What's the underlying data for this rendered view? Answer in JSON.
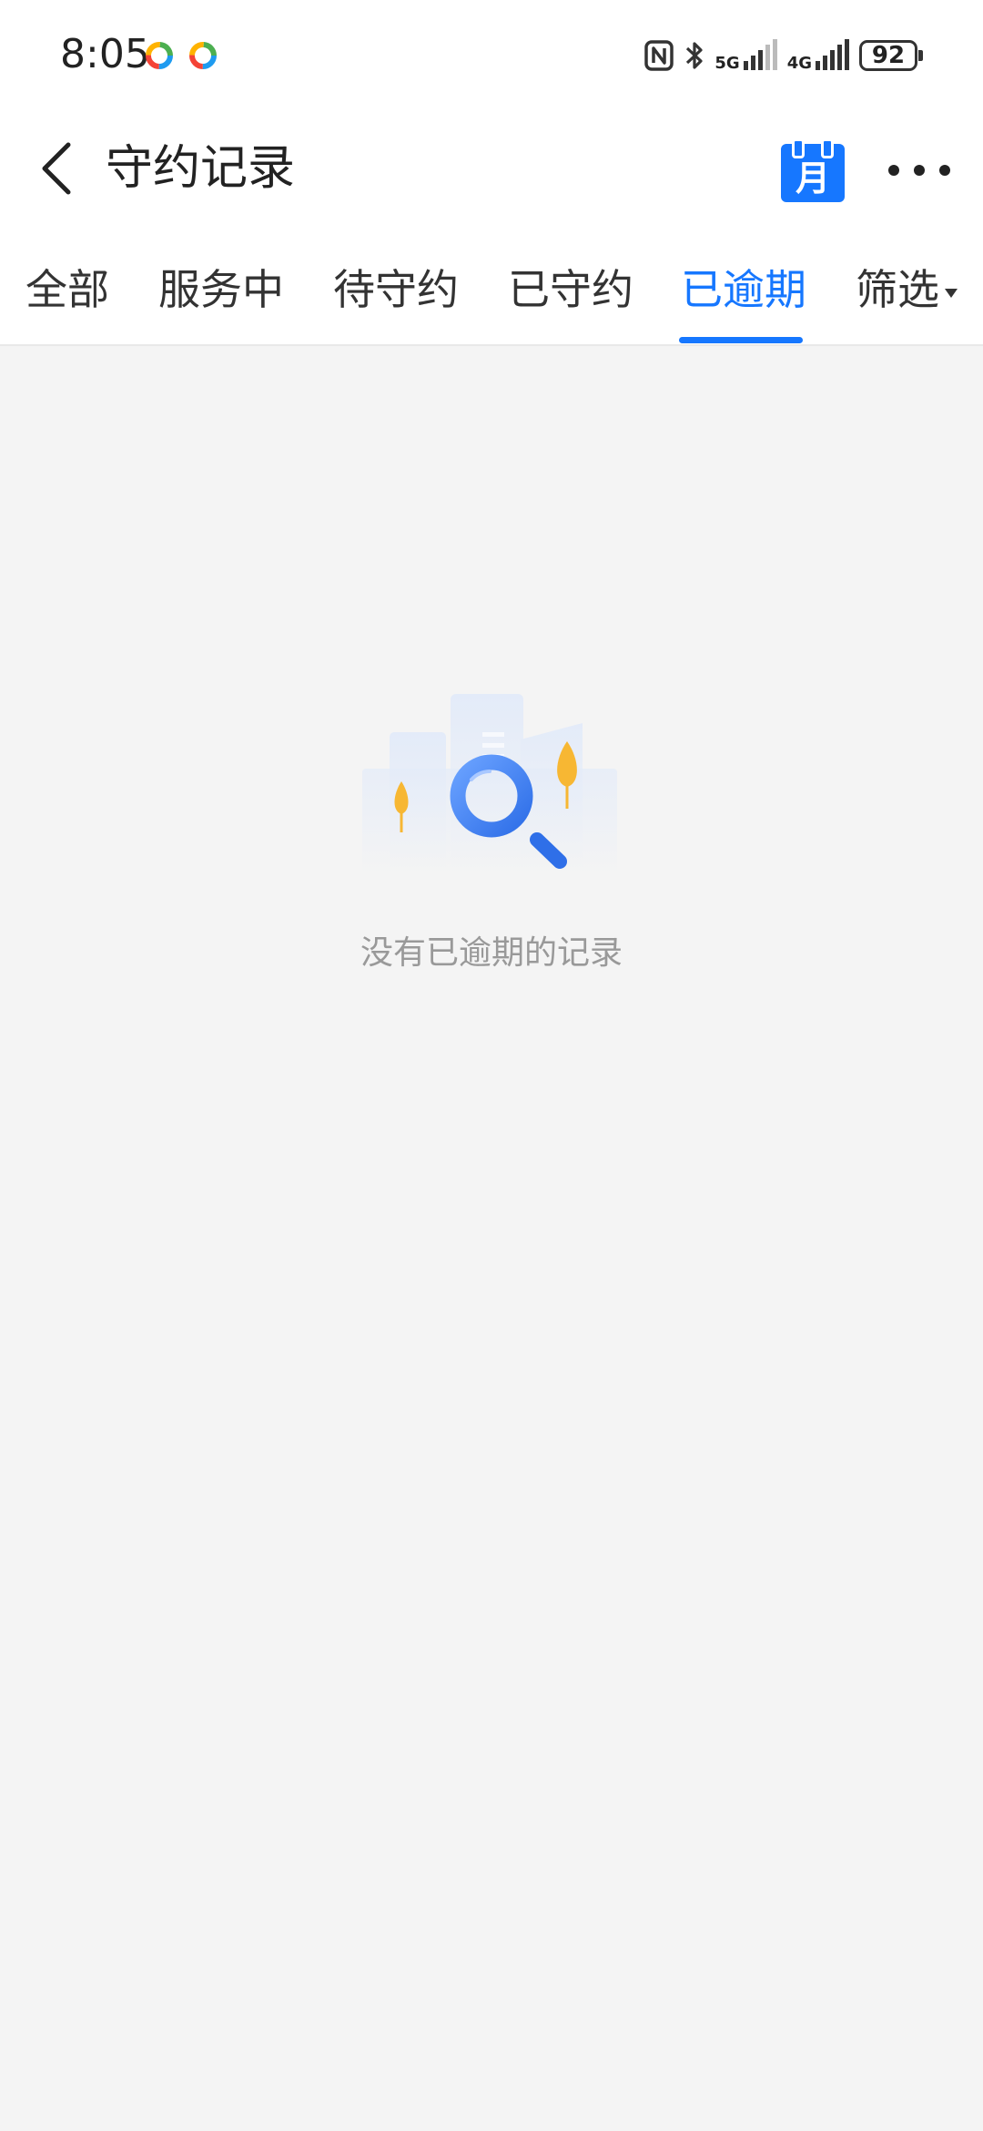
{
  "status_bar": {
    "time": "8:05",
    "network_5g": "5G",
    "network_4g": "4G",
    "battery_level": "92",
    "icons": [
      "app-notification-icon",
      "app-notification-icon",
      "nfc-icon",
      "bluetooth-icon",
      "signal-icon",
      "signal-icon",
      "battery-icon"
    ]
  },
  "nav": {
    "title": "守约记录",
    "calendar_label": "月",
    "icons": [
      "back-arrow-icon",
      "calendar-icon",
      "more-icon"
    ]
  },
  "tabs": {
    "items": [
      {
        "label": "全部",
        "active": false
      },
      {
        "label": "服务中",
        "active": false
      },
      {
        "label": "待守约",
        "active": false
      },
      {
        "label": "已守约",
        "active": false
      },
      {
        "label": "已逾期",
        "active": true
      },
      {
        "label": "筛选",
        "active": false
      }
    ],
    "active_color": "#1677ff"
  },
  "empty_state": {
    "message": "没有已逾期的记录",
    "icon": "magnifier-search-icon"
  },
  "colors": {
    "accent": "#1677ff",
    "background": "#f4f4f4",
    "illustration_yellow": "#f7b733"
  }
}
